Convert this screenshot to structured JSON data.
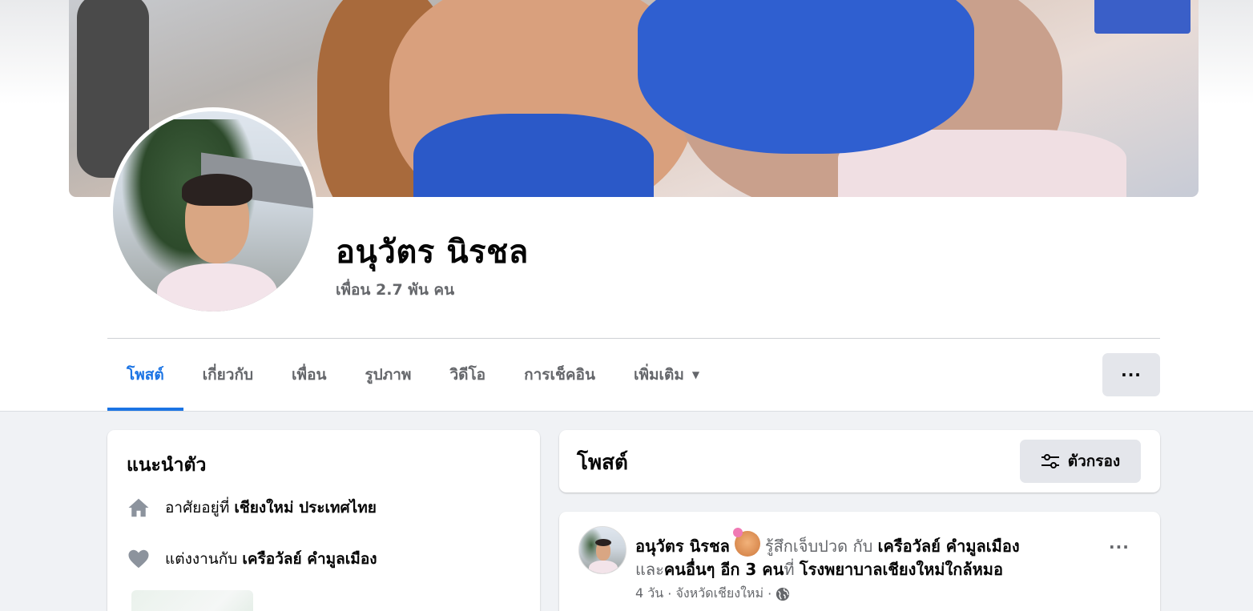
{
  "profile": {
    "name": "อนุวัตร นิรชล",
    "friends": "เพื่อน 2.7 พัน คน"
  },
  "tabs": [
    {
      "label": "โพสต์",
      "active": true
    },
    {
      "label": "เกี่ยวกับ",
      "active": false
    },
    {
      "label": "เพื่อน",
      "active": false
    },
    {
      "label": "รูปภาพ",
      "active": false
    },
    {
      "label": "วิดีโอ",
      "active": false
    },
    {
      "label": "การเช็คอิน",
      "active": false
    },
    {
      "label": "เพิ่มเติม",
      "active": false,
      "icon": "caret-down-icon"
    }
  ],
  "more_button": {
    "label": "···",
    "icon": "more-horizontal-icon"
  },
  "intro": {
    "title": "แนะนำตัว",
    "lives_in": {
      "prefix": "อาศัยอยู่ที่",
      "value": "เชียงใหม่ ประเทศไทย",
      "icon": "home-icon"
    },
    "married": {
      "prefix": "แต่งงานกับ",
      "value": "เครือวัลย์ คำมูลเมือง",
      "icon": "heart-icon"
    }
  },
  "posts_header": {
    "title": "โพสต์",
    "filter_label": "ตัวกรอง",
    "filter_icon": "sliders-icon"
  },
  "post": {
    "author": "อนุวัตร นิรชล",
    "feeling": "รู้สึกเจ็บปวด",
    "with_word": "กับ",
    "tagged": "เครือวัลย์ คำมูลเมือง",
    "and_word": "และ",
    "others": "คนอื่นๆ อีก 3 คน",
    "at_word": "ที่",
    "place": "โรงพยาบาลเชียงใหม่ใกล้หมอ",
    "time": "4 วัน",
    "location": "จังหวัดเชียงใหม่",
    "privacy_icon": "globe-icon",
    "menu_label": "···"
  },
  "colors": {
    "accent": "#1b74e4",
    "background": "#f0f2f5",
    "secondary_text": "#65676b",
    "button_gray": "#e4e6eb"
  }
}
